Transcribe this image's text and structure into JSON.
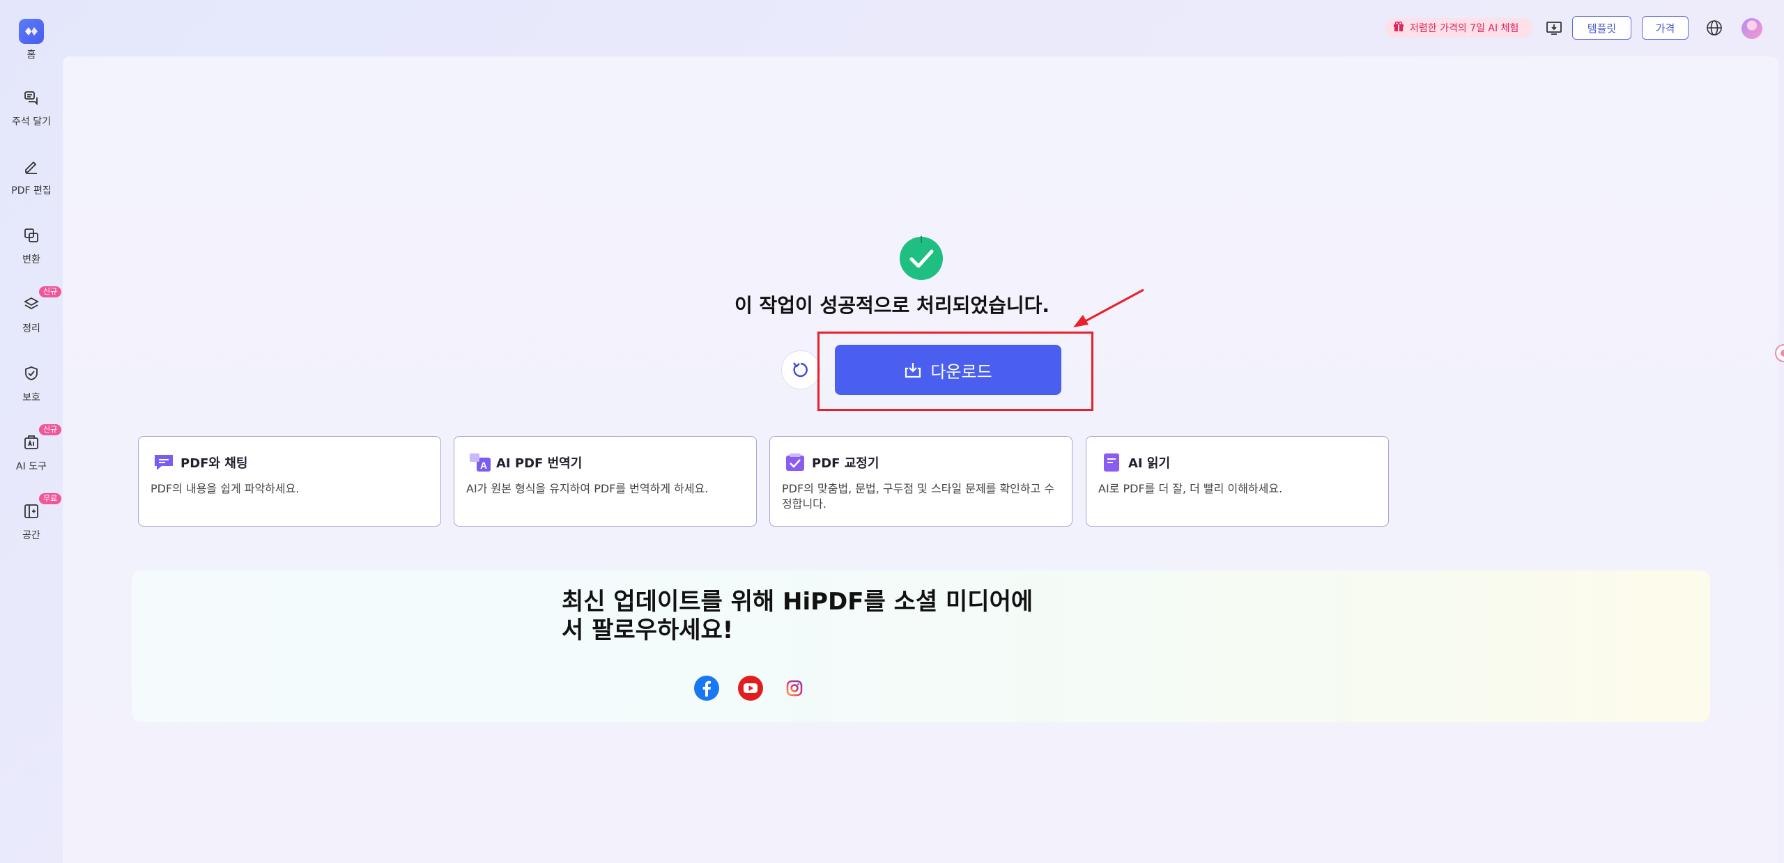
{
  "sidebar": {
    "home_label": "홈",
    "items": [
      {
        "label": "주석 달기",
        "icon": "annotate-icon",
        "badge": ""
      },
      {
        "label": "PDF 편집",
        "icon": "edit-pen-icon",
        "badge": ""
      },
      {
        "label": "변환",
        "icon": "convert-icon",
        "badge": ""
      },
      {
        "label": "정리",
        "icon": "layers-icon",
        "badge": "신규"
      },
      {
        "label": "보호",
        "icon": "shield-check-icon",
        "badge": ""
      },
      {
        "label": "AI 도구",
        "icon": "ai-tools-icon",
        "badge": "신규"
      },
      {
        "label": "공간",
        "icon": "space-icon",
        "badge": "무료"
      }
    ]
  },
  "topbar": {
    "promo": "저렴한 가격의 7일 AI 체험",
    "template_button": "템플릿",
    "price_button": "가격"
  },
  "result": {
    "message": "이 작업이 성공적으로 처리되었습니다.",
    "download_label": "다운로드"
  },
  "cards": [
    {
      "title": "PDF와 채팅",
      "desc": "PDF의 내용을 쉽게 파악하세요.",
      "icon": "chat-pdf-icon"
    },
    {
      "title": "AI PDF 번역기",
      "desc": "AI가 원본 형식을 유지하여 PDF를 번역하게 하세요.",
      "icon": "translate-icon"
    },
    {
      "title": "PDF 교정기",
      "desc": "PDF의 맞춤법, 문법, 구두점 및 스타일 문제를 확인하고 수정합니다.",
      "icon": "proofread-icon"
    },
    {
      "title": "AI 읽기",
      "desc": "AI로 PDF를 더 잘, 더 빨리 이해하세요.",
      "icon": "ai-read-icon"
    }
  ],
  "social": {
    "title": "최신 업데이트를 위해 HiPDF를 소셜 미디어에서 팔로우하세요!",
    "links": [
      "facebook-icon",
      "youtube-icon",
      "instagram-icon"
    ]
  },
  "colors": {
    "accent": "#4a5ff0",
    "success": "#1fbf82",
    "highlight": "#e8202a",
    "badge": "#f0579a"
  }
}
